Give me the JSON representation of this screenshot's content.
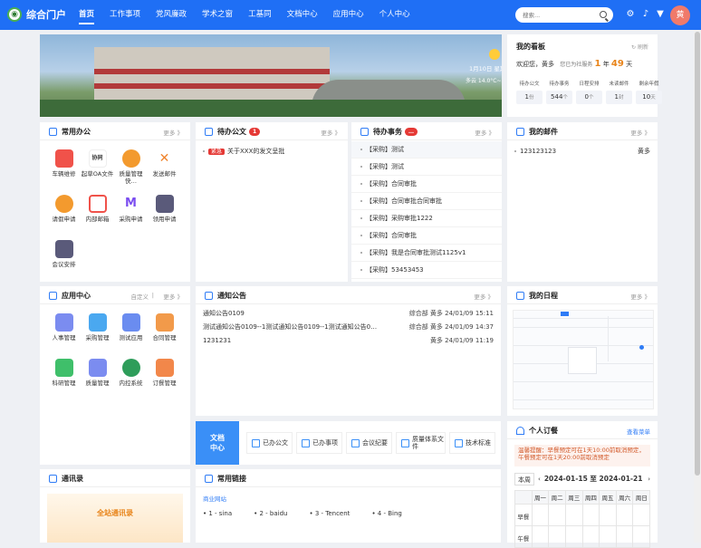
{
  "header": {
    "app_title": "综合门户",
    "nav": [
      "首页",
      "工作事项",
      "党风廉政",
      "学术之窗",
      "工基同",
      "文档中心",
      "应用中心",
      "个人中心"
    ],
    "search_placeholder": "搜索...",
    "avatar_text": "黄"
  },
  "banner": {
    "date": "1月10日  星期五",
    "weather": "多云 14.0°C~26.0°C"
  },
  "board": {
    "title": "我的看板",
    "refresh": "刷新",
    "welcome_prefix": "欢迎您，黄多",
    "welcome_mid": "您已为社服务",
    "years": "1",
    "year_unit": "年",
    "days": "49",
    "day_unit": "天",
    "stats": [
      {
        "label": "待办公文",
        "value": "1",
        "unit": "份"
      },
      {
        "label": "待办事务",
        "value": "544",
        "unit": "个"
      },
      {
        "label": "日程安排",
        "value": "0",
        "unit": "个"
      },
      {
        "label": "未读邮件",
        "value": "1",
        "unit": "封"
      },
      {
        "label": "剩余年假",
        "value": "10",
        "unit": "天"
      }
    ]
  },
  "common_office": {
    "title": "常用办公",
    "more": "更多 》",
    "apps": [
      {
        "label": "车辆维修",
        "color": "#f0524a"
      },
      {
        "label": "起草OA文件",
        "color": "#ffffff"
      },
      {
        "label": "质量管理快…",
        "color": "#f0f0f0"
      },
      {
        "label": "发送邮件",
        "color": "#ffffff"
      },
      {
        "label": "请假申请",
        "color": "#ffffff"
      },
      {
        "label": "内部邮箱",
        "color": "#ffffff"
      },
      {
        "label": "采购申请",
        "color": "#ffffff"
      },
      {
        "label": "领用申请",
        "color": "#5a5a7a"
      },
      {
        "label": "会议安排",
        "color": "#5a5a7a"
      }
    ]
  },
  "pending_docs": {
    "title": "待办公文",
    "badge": "1",
    "more": "更多 》",
    "items": [
      {
        "tag": "紧急",
        "text": "关于XXX的发文呈批"
      }
    ]
  },
  "pending_tasks": {
    "title": "待办事务",
    "badge": "…",
    "more": "更多 》",
    "items": [
      "【采购】测试",
      "【采购】测试",
      "【采购】合同审批",
      "【采购】合同审批合同审批",
      "【采购】采购审批1222",
      "【采购】合同审批",
      "【采购】我是合同审批测试1125v1",
      "【采购】53453453"
    ]
  },
  "mail": {
    "title": "我的邮件",
    "more": "更多 》",
    "items": [
      {
        "subject": "123123123",
        "sender": "黄多"
      }
    ]
  },
  "app_center": {
    "title": "应用中心",
    "customize": "自定义",
    "more": "更多 》",
    "apps": [
      {
        "label": "人事管理",
        "color": "#7b8cf0"
      },
      {
        "label": "采购管理",
        "color": "#4aa8f0"
      },
      {
        "label": "测试应用",
        "color": "#6a8cf0"
      },
      {
        "label": "合同管理",
        "color": "#f29a4a"
      },
      {
        "label": "科研管理",
        "color": "#3fbf6a"
      },
      {
        "label": "质量管理",
        "color": "#7b8cf0"
      },
      {
        "label": "内控系统",
        "color": "#2e9d5a"
      },
      {
        "label": "订餐管理",
        "color": "#f2874a"
      }
    ]
  },
  "notice": {
    "title": "通知公告",
    "more": "更多 》",
    "items": [
      {
        "title": "通知公告0109",
        "meta": "综合部 黄多 24/01/09 15:11"
      },
      {
        "title": "测试通知公告0109--1测试通知公告0109--1测试通知公告0…",
        "meta": "综合部 黄多 24/01/09 14:37"
      },
      {
        "title": "1231231",
        "meta": "黄多 24/01/09 11:19"
      }
    ]
  },
  "schedule": {
    "title": "我的日程",
    "more": "更多 》"
  },
  "doc_center": {
    "tab": "文档\n中心",
    "items": [
      "已办公文",
      "已办事项",
      "会议纪要",
      "质量体系文件",
      "技术标准"
    ]
  },
  "meal_order": {
    "title": "个人订餐",
    "view_menu": "查看菜单",
    "note": "温馨提醒：早餐预定可在1天10:00前取消预定，午餐预定可在1天20:00前取消预定",
    "week_label": "本周",
    "range": "2024-01-15 至 2024-01-21",
    "days": [
      "周一",
      "周二",
      "周三",
      "周四",
      "周五",
      "周六",
      "周日"
    ],
    "meals": [
      "早餐",
      "午餐"
    ]
  },
  "contacts": {
    "title": "通讯录",
    "banner_text": "全站通讯录"
  },
  "links": {
    "title": "常用链接",
    "category": "商业网站",
    "items": [
      "1 - sina",
      "2 - baidu",
      "3 - Tencent",
      "4 - Bing"
    ]
  }
}
